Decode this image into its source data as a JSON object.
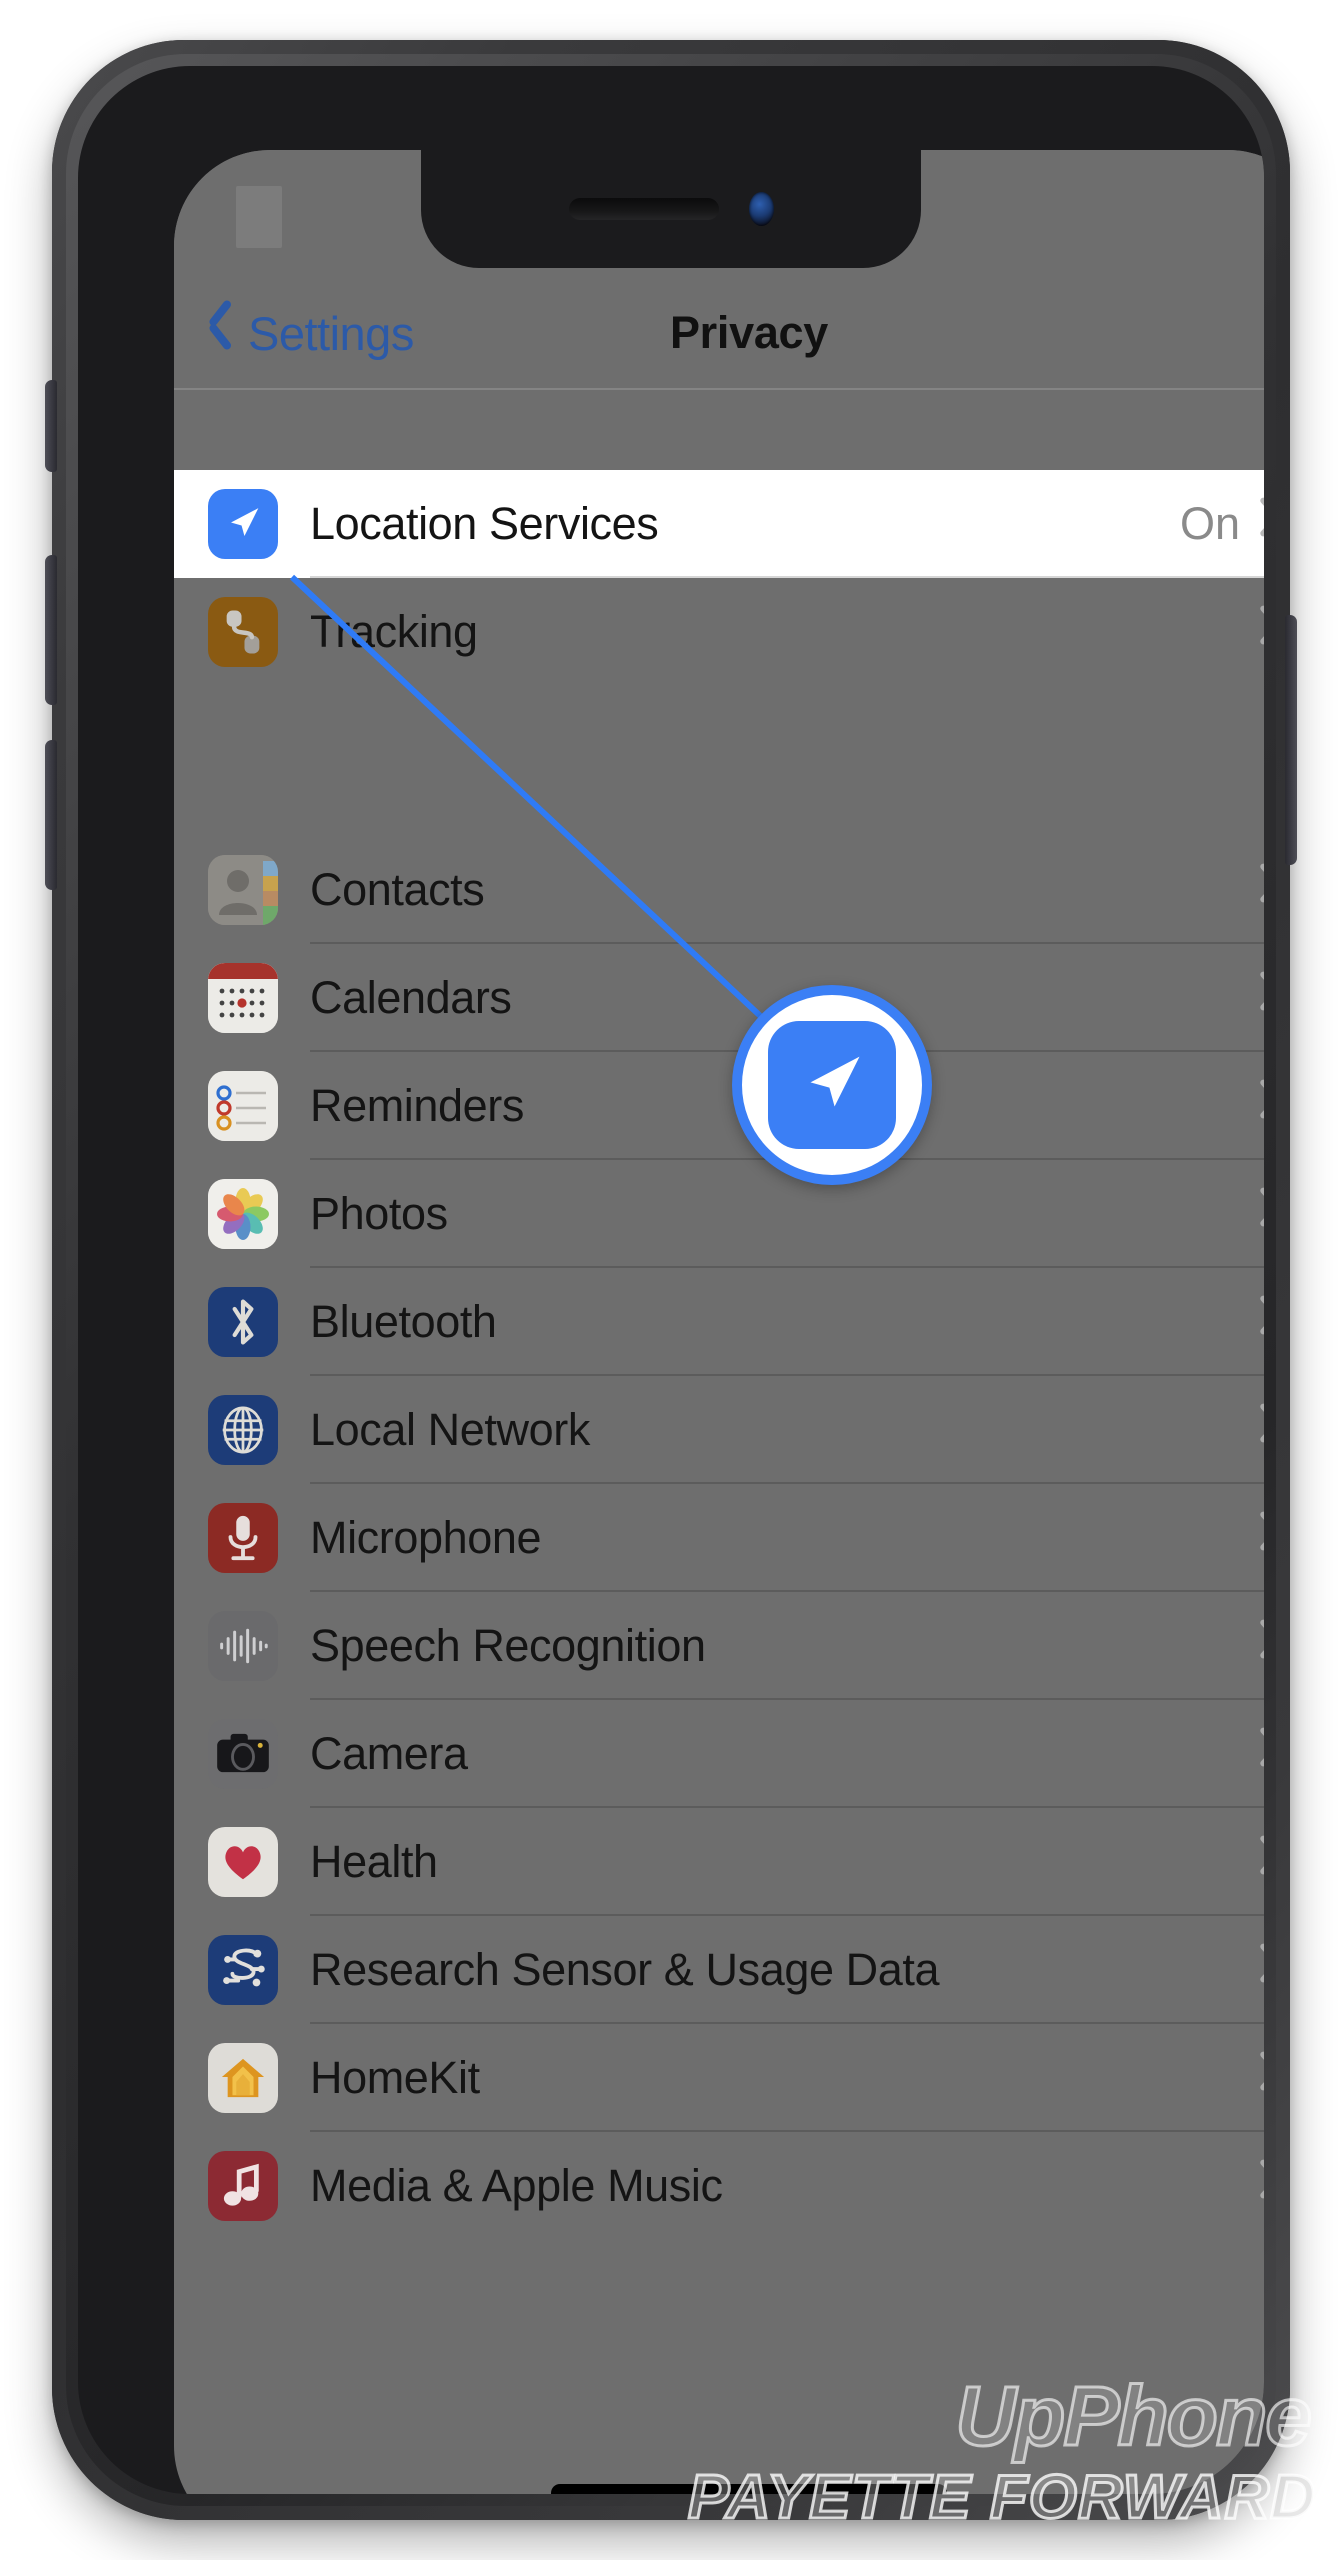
{
  "device": {
    "type": "iphone-with-notch",
    "frame_color": "#3a3a3c",
    "screen_background": "#6e6e6e"
  },
  "navbar": {
    "back_label": "Settings",
    "back_icon": "chevron-left-icon",
    "title": "Privacy"
  },
  "colors": {
    "accent_blue": "#3b7ff5",
    "link_blue": "#2c5aa8",
    "dimmed_overlay": "#6e6e6e",
    "highlight_row_bg": "#ffffff"
  },
  "groups": [
    {
      "id": "location-group",
      "rows": [
        {
          "label": "Location Services",
          "icon": "location-arrow-icon",
          "icon_color": "#3b7ff5",
          "value": "On",
          "accessory": "chevron-right-icon",
          "highlighted": true
        },
        {
          "label": "Tracking",
          "icon": "tracking-icon",
          "icon_color": "#8a5a12",
          "value": "",
          "accessory": "chevron-right-icon",
          "highlighted": false
        }
      ]
    },
    {
      "id": "permissions-group",
      "rows": [
        {
          "label": "Contacts",
          "icon": "contacts-icon",
          "icon_color": "#8d8b86",
          "value": "",
          "accessory": "chevron-right-icon",
          "highlighted": false
        },
        {
          "label": "Calendars",
          "icon": "calendar-icon",
          "icon_color": "#d6d4cf",
          "value": "",
          "accessory": "chevron-right-icon",
          "highlighted": false
        },
        {
          "label": "Reminders",
          "icon": "reminders-icon",
          "icon_color": "#d9d7d2",
          "value": "",
          "accessory": "chevron-right-icon",
          "highlighted": false
        },
        {
          "label": "Photos",
          "icon": "photos-icon",
          "icon_color": "#e2e0db",
          "value": "",
          "accessory": "chevron-right-icon",
          "highlighted": false
        },
        {
          "label": "Bluetooth",
          "icon": "bluetooth-icon",
          "icon_color": "#1d3c78",
          "value": "",
          "accessory": "chevron-right-icon",
          "highlighted": false
        },
        {
          "label": "Local Network",
          "icon": "globe-icon",
          "icon_color": "#1d3c78",
          "value": "",
          "accessory": "chevron-right-icon",
          "highlighted": false
        },
        {
          "label": "Microphone",
          "icon": "microphone-icon",
          "icon_color": "#8c2a24",
          "value": "",
          "accessory": "chevron-right-icon",
          "highlighted": false
        },
        {
          "label": "Speech Recognition",
          "icon": "waveform-icon",
          "icon_color": "#6a6a6c",
          "value": "",
          "accessory": "chevron-right-icon",
          "highlighted": false
        },
        {
          "label": "Camera",
          "icon": "camera-icon",
          "icon_color": "#6d6d6f",
          "value": "",
          "accessory": "chevron-right-icon",
          "highlighted": false
        },
        {
          "label": "Health",
          "icon": "heart-icon",
          "icon_color": "#e4e2dd",
          "value": "",
          "accessory": "chevron-right-icon",
          "highlighted": false
        },
        {
          "label": "Research Sensor & Usage Data",
          "icon": "research-sensor-icon",
          "icon_color": "#1d3c78",
          "value": "",
          "accessory": "chevron-right-icon",
          "highlighted": false
        },
        {
          "label": "HomeKit",
          "icon": "home-icon",
          "icon_color": "#dedcd7",
          "value": "",
          "accessory": "chevron-right-icon",
          "highlighted": false
        },
        {
          "label": "Media & Apple Music",
          "icon": "music-note-icon",
          "icon_color": "#8c2a33",
          "value": "",
          "accessory": "chevron-right-icon",
          "highlighted": false
        }
      ]
    }
  ],
  "callout": {
    "target_row": "Location Services",
    "icon": "location-arrow-icon",
    "ring_color": "#3b7ff5",
    "line_color": "#2f7bf6"
  },
  "watermark": {
    "brand": "UpPhone",
    "tagline": "PAYETTE FORWARD"
  }
}
